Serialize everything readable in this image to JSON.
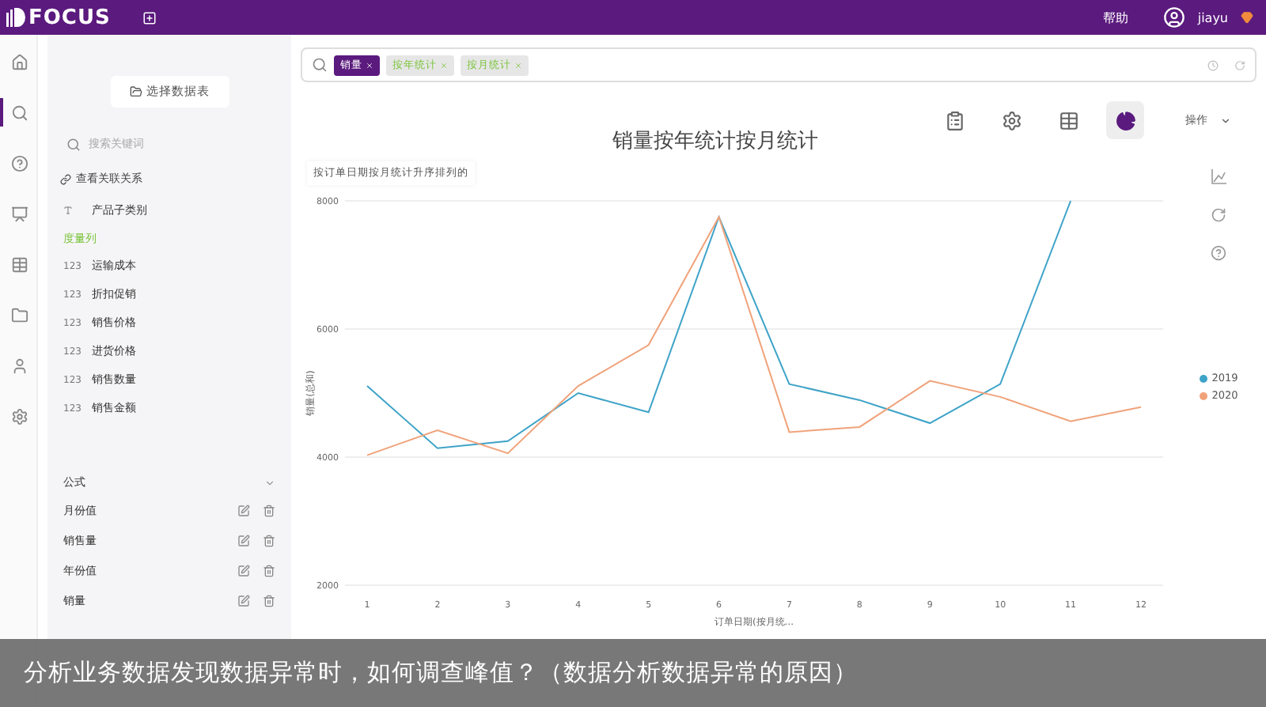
{
  "top_bar": {
    "logo": "FOCUS",
    "help": "帮助",
    "user": "jiayu"
  },
  "rail": [
    {
      "kind": "home",
      "selected": false
    },
    {
      "kind": "search",
      "selected": true
    },
    {
      "kind": "help",
      "selected": false
    },
    {
      "kind": "board",
      "selected": false
    },
    {
      "kind": "table",
      "selected": false
    },
    {
      "kind": "folder",
      "selected": false
    },
    {
      "kind": "user",
      "selected": false
    },
    {
      "kind": "settings",
      "selected": false
    }
  ],
  "sidebar": {
    "table_button": "选择数据表",
    "search_placeholder": "搜索关键词",
    "relations_link": "查看关联关系",
    "attribute_columns": [
      {
        "name": "产品子类别"
      }
    ],
    "measure_heading": "度量列",
    "measures": [
      {
        "type_label": "123",
        "name": "运输成本"
      },
      {
        "type_label": "123",
        "name": "折扣促销"
      },
      {
        "type_label": "123",
        "name": "销售价格"
      },
      {
        "type_label": "123",
        "name": "进货价格"
      },
      {
        "type_label": "123",
        "name": "销售数量"
      },
      {
        "type_label": "123",
        "name": "销售金额"
      }
    ],
    "formulas": {
      "title": "公式",
      "expanded": true,
      "items": [
        "月份值",
        "销售量",
        "年份值",
        "销量"
      ]
    }
  },
  "search_tokens": [
    {
      "text": "销量",
      "kind": "measure"
    },
    {
      "text": "按年统计",
      "kind": "attribute"
    },
    {
      "text": "按月统计",
      "kind": "attribute"
    }
  ],
  "chart_tools": [
    {
      "kind": "report",
      "selected": false
    },
    {
      "kind": "settings",
      "selected": false
    },
    {
      "kind": "table",
      "selected": false
    },
    {
      "kind": "pie",
      "selected": true
    }
  ],
  "actions_label": "操作",
  "chart": {
    "title": "销量按年统计按月统计",
    "subtitle": "按订单日期按月统计升序排列的",
    "chart_data": {
      "type": "line",
      "xlabel": "订单日期(按月统...",
      "ylabel": "销量(总和)",
      "categories": [
        "1",
        "2",
        "3",
        "4",
        "5",
        "6",
        "7",
        "8",
        "9",
        "10",
        "11",
        "12"
      ],
      "yticks": [
        2000,
        4000,
        6000,
        8000
      ],
      "ylim": [
        2000,
        8000
      ],
      "grid": true,
      "series": [
        {
          "name": "2019",
          "color": "#3ea3c8",
          "values": [
            5110,
            4140,
            4250,
            5000,
            4700,
            7750,
            5140,
            4890,
            4530,
            5140,
            8000,
            null
          ]
        },
        {
          "name": "2020",
          "color": "#f0a27a",
          "values": [
            4030,
            4420,
            4060,
            5110,
            5750,
            7750,
            4390,
            4470,
            5190,
            4940,
            4560,
            4780
          ]
        }
      ]
    }
  },
  "caption": "分析业务数据发现数据异常时，如何调查峰值？（数据分析数据异常的原因）"
}
